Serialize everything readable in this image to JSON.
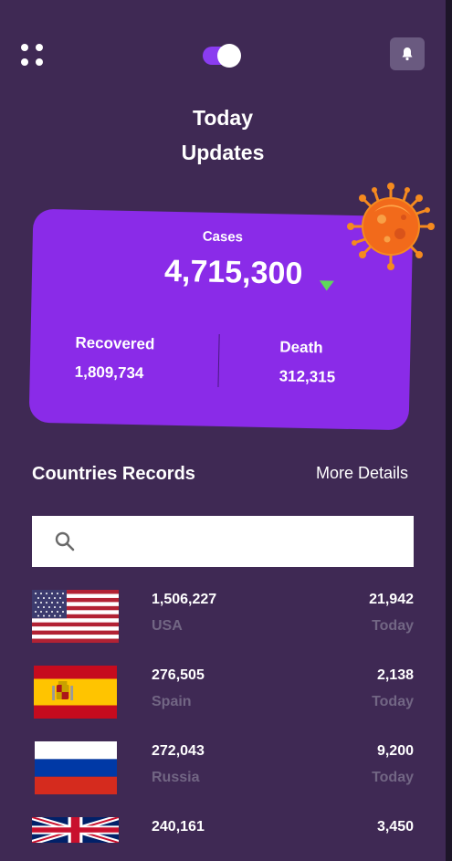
{
  "header": {
    "title_line1": "Today",
    "title_line2": "Updates",
    "menu_icon": "grid-dots-icon",
    "toggle_icon": "theme-toggle",
    "bell_icon": "bell-icon"
  },
  "summary": {
    "cases_label": "Cases",
    "cases_value": "4,715,300",
    "trend_icon": "down-arrow-icon",
    "recovered_label": "Recovered",
    "recovered_value": "1,809,734",
    "death_label": "Death",
    "death_value": "312,315",
    "illustration": "virus-icon"
  },
  "records": {
    "title": "Countries Records",
    "more_details": "More Details",
    "search_placeholder": "",
    "search_icon": "search-icon",
    "countries": [
      {
        "cases": "1,506,227",
        "name": "USA",
        "deaths": "21,942",
        "period": "Today"
      },
      {
        "cases": "276,505",
        "name": "Spain",
        "deaths": "2,138",
        "period": "Today"
      },
      {
        "cases": "272,043",
        "name": "Russia",
        "deaths": "9,200",
        "period": "Today"
      },
      {
        "cases": "240,161",
        "name": "",
        "deaths": "3,450",
        "period": ""
      }
    ]
  },
  "colors": {
    "background": "#3f2954",
    "card": "#8a2be8",
    "accent": "#8a3cf0",
    "trend_down": "#5fd85a",
    "muted_text": "#726684"
  }
}
